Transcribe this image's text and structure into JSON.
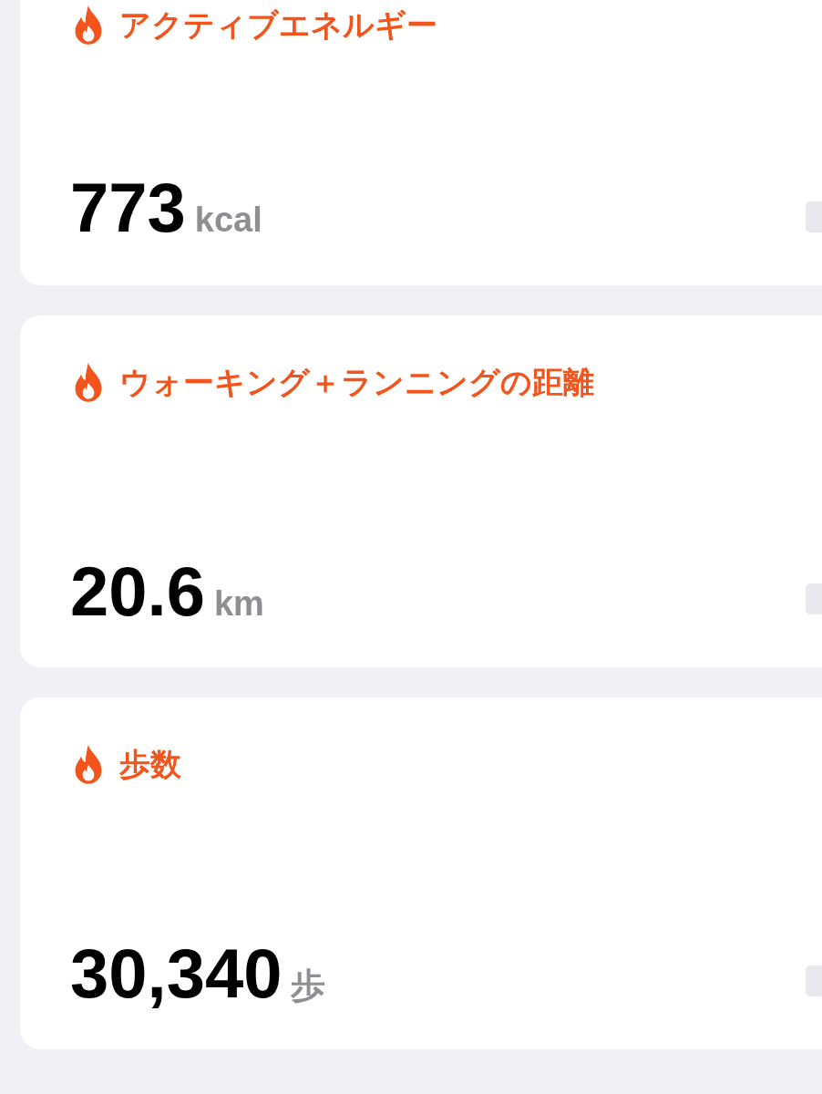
{
  "cards": [
    {
      "title": "アクティブエネルギー",
      "value": "773",
      "unit": "kcal"
    },
    {
      "title": "ウォーキング＋ランニングの距離",
      "value": "20.6",
      "unit": "km"
    },
    {
      "title": "歩数",
      "value": "30,340",
      "unit": "歩"
    }
  ]
}
